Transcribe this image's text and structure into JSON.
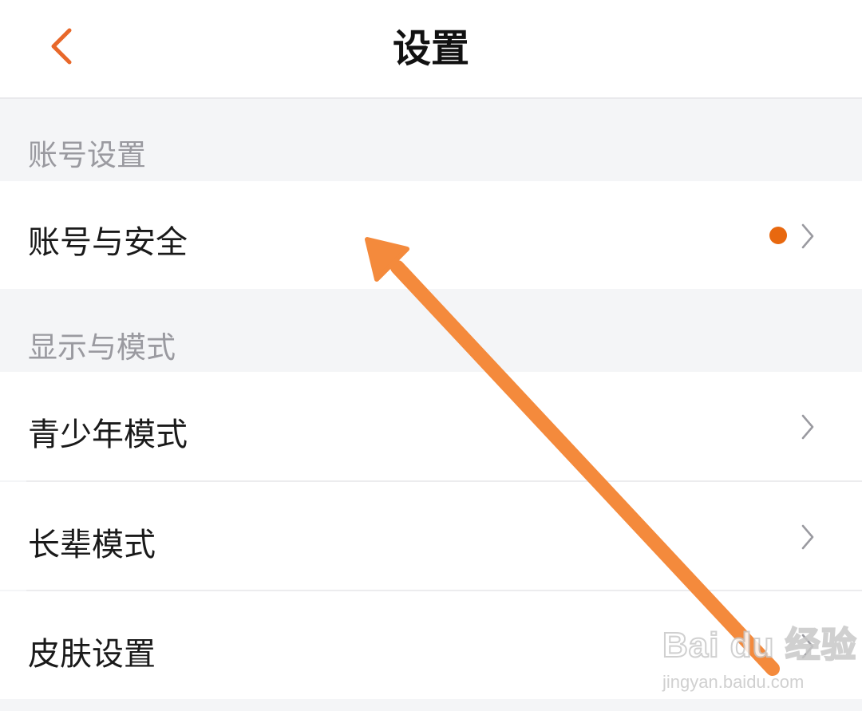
{
  "header": {
    "title": "设置",
    "back_icon": "chevron-left-icon",
    "back_color": "#e8682a"
  },
  "sections": [
    {
      "title": "账号设置",
      "items": [
        {
          "label": "账号与安全",
          "has_dot": true,
          "dot_color": "#e8680f"
        }
      ]
    },
    {
      "title": "显示与模式",
      "items": [
        {
          "label": "青少年模式",
          "has_dot": false
        },
        {
          "label": "长辈模式",
          "has_dot": false
        },
        {
          "label": "皮肤设置",
          "has_dot": false
        }
      ]
    }
  ],
  "annotation": {
    "arrow_color": "#f48a3c",
    "arrow_icon": "arrow-up-left-icon"
  },
  "watermark": {
    "line1": "Bai du 经验",
    "line2": "jingyan.baidu.com"
  }
}
